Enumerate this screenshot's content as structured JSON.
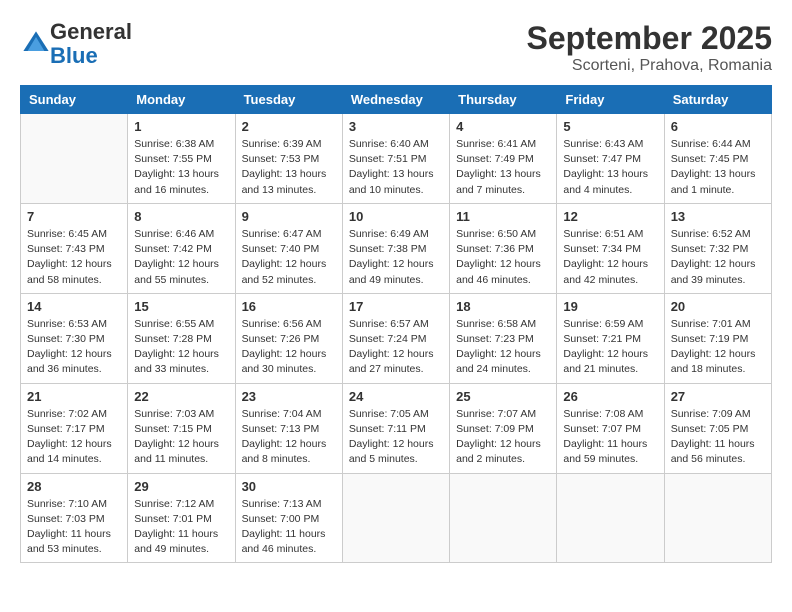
{
  "header": {
    "logo": {
      "general": "General",
      "blue": "Blue"
    },
    "month": "September 2025",
    "location": "Scorteni, Prahova, Romania"
  },
  "weekdays": [
    "Sunday",
    "Monday",
    "Tuesday",
    "Wednesday",
    "Thursday",
    "Friday",
    "Saturday"
  ],
  "weeks": [
    [
      {
        "day": "",
        "info": ""
      },
      {
        "day": "1",
        "info": "Sunrise: 6:38 AM\nSunset: 7:55 PM\nDaylight: 13 hours\nand 16 minutes."
      },
      {
        "day": "2",
        "info": "Sunrise: 6:39 AM\nSunset: 7:53 PM\nDaylight: 13 hours\nand 13 minutes."
      },
      {
        "day": "3",
        "info": "Sunrise: 6:40 AM\nSunset: 7:51 PM\nDaylight: 13 hours\nand 10 minutes."
      },
      {
        "day": "4",
        "info": "Sunrise: 6:41 AM\nSunset: 7:49 PM\nDaylight: 13 hours\nand 7 minutes."
      },
      {
        "day": "5",
        "info": "Sunrise: 6:43 AM\nSunset: 7:47 PM\nDaylight: 13 hours\nand 4 minutes."
      },
      {
        "day": "6",
        "info": "Sunrise: 6:44 AM\nSunset: 7:45 PM\nDaylight: 13 hours\nand 1 minute."
      }
    ],
    [
      {
        "day": "7",
        "info": "Sunrise: 6:45 AM\nSunset: 7:43 PM\nDaylight: 12 hours\nand 58 minutes."
      },
      {
        "day": "8",
        "info": "Sunrise: 6:46 AM\nSunset: 7:42 PM\nDaylight: 12 hours\nand 55 minutes."
      },
      {
        "day": "9",
        "info": "Sunrise: 6:47 AM\nSunset: 7:40 PM\nDaylight: 12 hours\nand 52 minutes."
      },
      {
        "day": "10",
        "info": "Sunrise: 6:49 AM\nSunset: 7:38 PM\nDaylight: 12 hours\nand 49 minutes."
      },
      {
        "day": "11",
        "info": "Sunrise: 6:50 AM\nSunset: 7:36 PM\nDaylight: 12 hours\nand 46 minutes."
      },
      {
        "day": "12",
        "info": "Sunrise: 6:51 AM\nSunset: 7:34 PM\nDaylight: 12 hours\nand 42 minutes."
      },
      {
        "day": "13",
        "info": "Sunrise: 6:52 AM\nSunset: 7:32 PM\nDaylight: 12 hours\nand 39 minutes."
      }
    ],
    [
      {
        "day": "14",
        "info": "Sunrise: 6:53 AM\nSunset: 7:30 PM\nDaylight: 12 hours\nand 36 minutes."
      },
      {
        "day": "15",
        "info": "Sunrise: 6:55 AM\nSunset: 7:28 PM\nDaylight: 12 hours\nand 33 minutes."
      },
      {
        "day": "16",
        "info": "Sunrise: 6:56 AM\nSunset: 7:26 PM\nDaylight: 12 hours\nand 30 minutes."
      },
      {
        "day": "17",
        "info": "Sunrise: 6:57 AM\nSunset: 7:24 PM\nDaylight: 12 hours\nand 27 minutes."
      },
      {
        "day": "18",
        "info": "Sunrise: 6:58 AM\nSunset: 7:23 PM\nDaylight: 12 hours\nand 24 minutes."
      },
      {
        "day": "19",
        "info": "Sunrise: 6:59 AM\nSunset: 7:21 PM\nDaylight: 12 hours\nand 21 minutes."
      },
      {
        "day": "20",
        "info": "Sunrise: 7:01 AM\nSunset: 7:19 PM\nDaylight: 12 hours\nand 18 minutes."
      }
    ],
    [
      {
        "day": "21",
        "info": "Sunrise: 7:02 AM\nSunset: 7:17 PM\nDaylight: 12 hours\nand 14 minutes."
      },
      {
        "day": "22",
        "info": "Sunrise: 7:03 AM\nSunset: 7:15 PM\nDaylight: 12 hours\nand 11 minutes."
      },
      {
        "day": "23",
        "info": "Sunrise: 7:04 AM\nSunset: 7:13 PM\nDaylight: 12 hours\nand 8 minutes."
      },
      {
        "day": "24",
        "info": "Sunrise: 7:05 AM\nSunset: 7:11 PM\nDaylight: 12 hours\nand 5 minutes."
      },
      {
        "day": "25",
        "info": "Sunrise: 7:07 AM\nSunset: 7:09 PM\nDaylight: 12 hours\nand 2 minutes."
      },
      {
        "day": "26",
        "info": "Sunrise: 7:08 AM\nSunset: 7:07 PM\nDaylight: 11 hours\nand 59 minutes."
      },
      {
        "day": "27",
        "info": "Sunrise: 7:09 AM\nSunset: 7:05 PM\nDaylight: 11 hours\nand 56 minutes."
      }
    ],
    [
      {
        "day": "28",
        "info": "Sunrise: 7:10 AM\nSunset: 7:03 PM\nDaylight: 11 hours\nand 53 minutes."
      },
      {
        "day": "29",
        "info": "Sunrise: 7:12 AM\nSunset: 7:01 PM\nDaylight: 11 hours\nand 49 minutes."
      },
      {
        "day": "30",
        "info": "Sunrise: 7:13 AM\nSunset: 7:00 PM\nDaylight: 11 hours\nand 46 minutes."
      },
      {
        "day": "",
        "info": ""
      },
      {
        "day": "",
        "info": ""
      },
      {
        "day": "",
        "info": ""
      },
      {
        "day": "",
        "info": ""
      }
    ]
  ]
}
